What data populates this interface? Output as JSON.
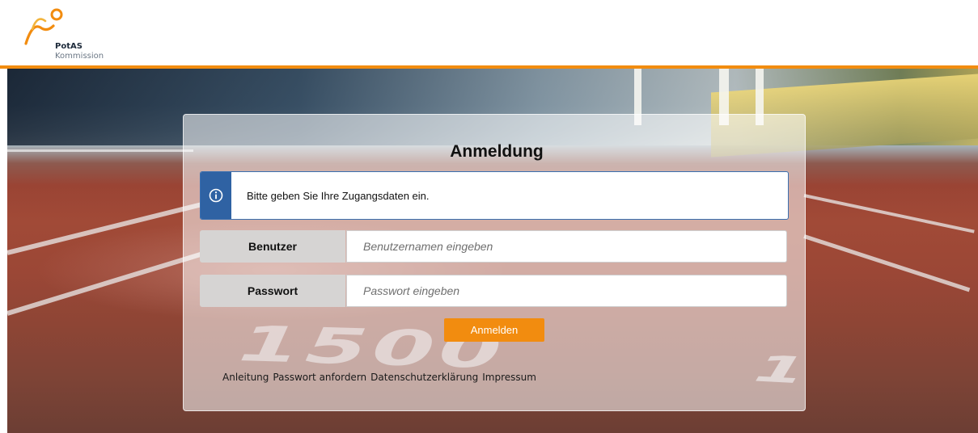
{
  "brand": {
    "name": "PotAS",
    "subtitle": "Kommission",
    "accent_color": "#f28c0f",
    "logo_icon": "runner-logo-icon"
  },
  "login": {
    "title": "Anmeldung",
    "info_icon": "info-icon",
    "info_message": "Bitte geben Sie Ihre Zugangsdaten ein.",
    "username_label": "Benutzer",
    "username_placeholder": "Benutzernamen eingeben",
    "username_value": "",
    "password_label": "Passwort",
    "password_placeholder": "Passwort eingeben",
    "password_value": "",
    "submit_label": "Anmelden"
  },
  "footer_links": [
    {
      "label": "Anleitung"
    },
    {
      "label": "Passwort anfordern"
    },
    {
      "label": "Datenschutzerklärung"
    },
    {
      "label": "Impressum"
    }
  ],
  "background": {
    "track_markings": [
      "1500",
      "1"
    ]
  }
}
